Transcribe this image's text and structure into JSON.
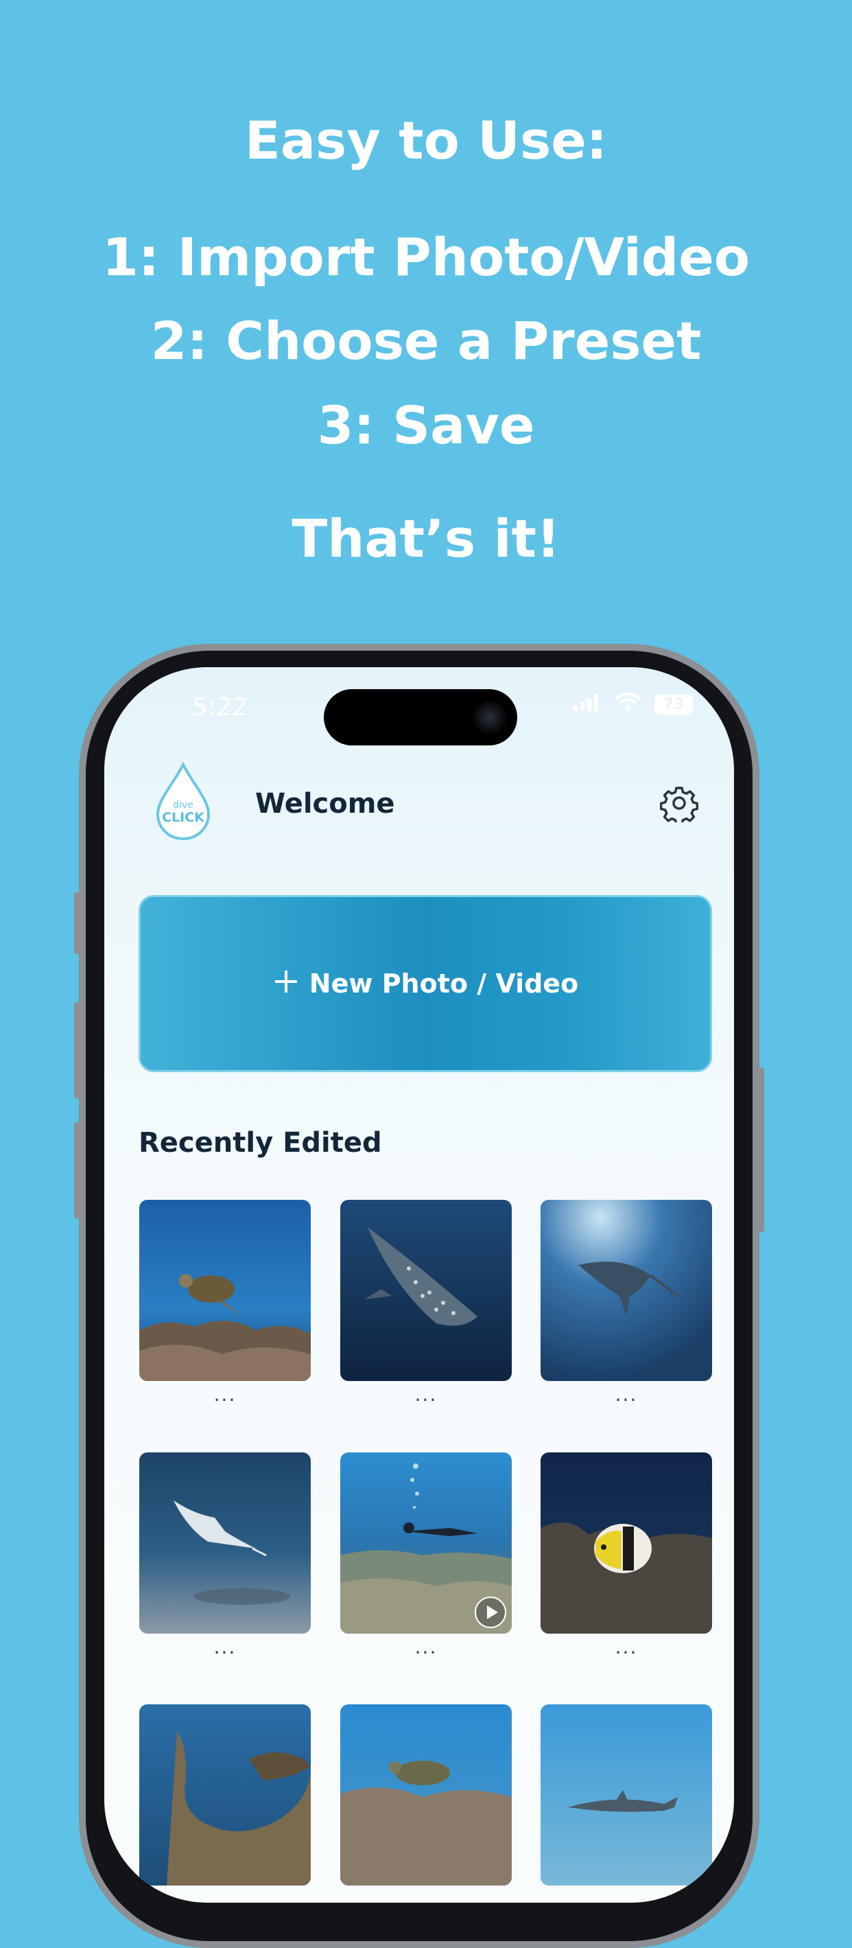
{
  "promo": {
    "title": "Easy to Use:",
    "steps": [
      "1: Import Photo/Video",
      "2: Choose a Preset",
      "3: Save"
    ],
    "closing": "That’s it!"
  },
  "status_bar": {
    "time": "5:22",
    "battery": "73"
  },
  "header": {
    "logo_small": "dive",
    "logo_big": "CLICK",
    "title": "Welcome",
    "settings_icon": "gear-icon"
  },
  "new_button": {
    "icon": "plus-icon",
    "label": "New Photo / Video"
  },
  "recent": {
    "title": "Recently Edited",
    "more_label": "...",
    "items": [
      {
        "subject": "sea turtle over reef"
      },
      {
        "subject": "whale shark"
      },
      {
        "subject": "manta ray"
      },
      {
        "subject": "manta ray over sand"
      },
      {
        "subject": "scuba diver over reef",
        "is_video": true
      },
      {
        "subject": "butterflyfish"
      },
      {
        "subject": "sea turtle close-up"
      },
      {
        "subject": "sea turtle on reef"
      },
      {
        "subject": "reef shark"
      }
    ]
  },
  "colors": {
    "background": "#5dc2e6",
    "accent": "#2ea0cc",
    "text_dark": "#13263a"
  }
}
